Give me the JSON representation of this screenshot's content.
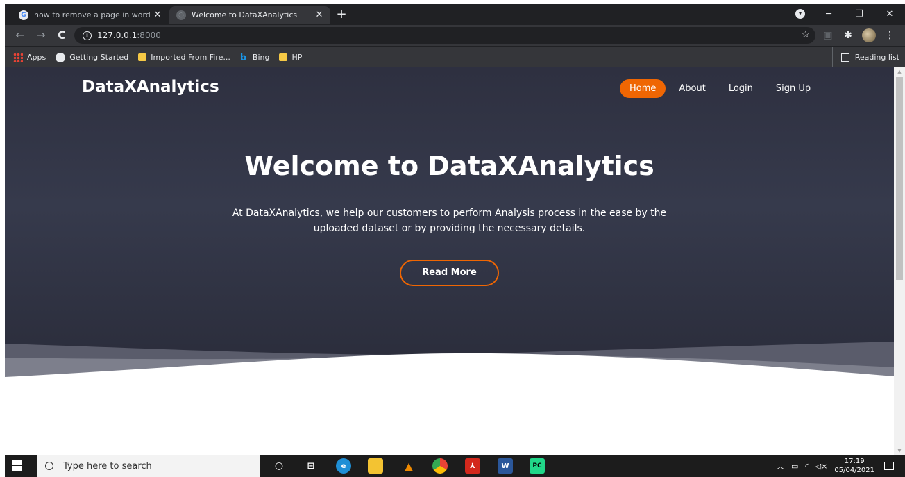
{
  "browser": {
    "tabs": [
      {
        "title": "how to remove a page in word -",
        "close": "✕",
        "active": false
      },
      {
        "title": "Welcome to DataXAnalytics",
        "close": "✕",
        "active": true
      }
    ],
    "new_tab": "+",
    "url_host": "127.0.0.1",
    "url_port": ":8000",
    "bookmarks": [
      {
        "label": "Apps",
        "icon": "apps-icon"
      },
      {
        "label": "Getting Started",
        "icon": "globe-icon"
      },
      {
        "label": "Imported From Fire...",
        "icon": "folder-icon"
      },
      {
        "label": "Bing",
        "icon": "bing-icon"
      },
      {
        "label": "HP",
        "icon": "folder-icon"
      }
    ],
    "reading_list": "Reading list"
  },
  "site": {
    "brand": "DataXAnalytics",
    "nav": [
      {
        "label": "Home",
        "active": true
      },
      {
        "label": "About",
        "active": false
      },
      {
        "label": "Login",
        "active": false
      },
      {
        "label": "Sign Up",
        "active": false
      }
    ],
    "hero_title": "Welcome to DataXAnalytics",
    "hero_line1": "At DataXAnalytics, we help our customers to perform Analysis process in the ease by the",
    "hero_line2": "uploaded dataset or by providing the necessary details.",
    "cta": "Read More",
    "accent_color": "#ef6603"
  },
  "taskbar": {
    "search_placeholder": "Type here to search",
    "time": "17:19",
    "date": "05/04/2021"
  }
}
